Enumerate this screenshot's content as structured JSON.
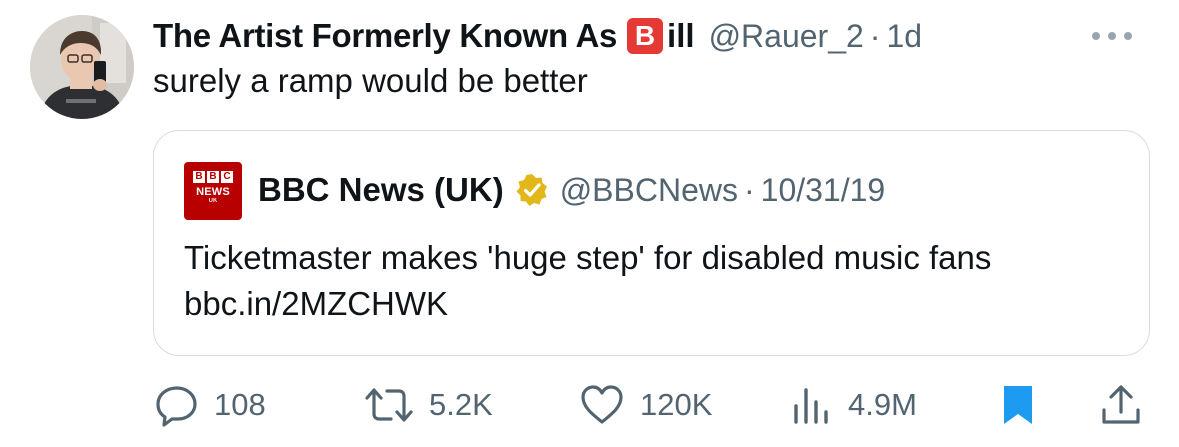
{
  "tweet": {
    "display_name": "The Artist Formerly Known As",
    "badge_letter": "B",
    "name_suffix": "ill",
    "handle": "@Rauer_2",
    "separator": "·",
    "time": "1d",
    "text": "surely a ramp would be better",
    "avatar": "avatar-photo",
    "more": "more-options-icon"
  },
  "quote": {
    "logo_letters": [
      "B",
      "B",
      "C"
    ],
    "logo_word": "NEWS",
    "logo_sub": "UK",
    "name": "BBC News (UK)",
    "verified": "verified-gold-badge-icon",
    "handle": "@BBCNews",
    "separator": "·",
    "date": "10/31/19",
    "line1": "Ticketmaster makes 'huge step' for disabled music fans",
    "line2": "bbc.in/2MZCHWK"
  },
  "actions": {
    "reply": {
      "icon": "reply-icon",
      "count": "108"
    },
    "retweet": {
      "icon": "retweet-icon",
      "count": "5.2K"
    },
    "like": {
      "icon": "heart-icon",
      "count": "120K"
    },
    "views": {
      "icon": "views-icon",
      "count": "4.9M"
    },
    "bookmark": {
      "icon": "bookmark-icon",
      "color": "#1d9bf0"
    },
    "share": {
      "icon": "share-icon"
    }
  },
  "colors": {
    "text": "#0f1419",
    "muted": "#536471",
    "accent": "#1d9bf0",
    "badge": "#e53935",
    "bbc": "#b80000"
  }
}
